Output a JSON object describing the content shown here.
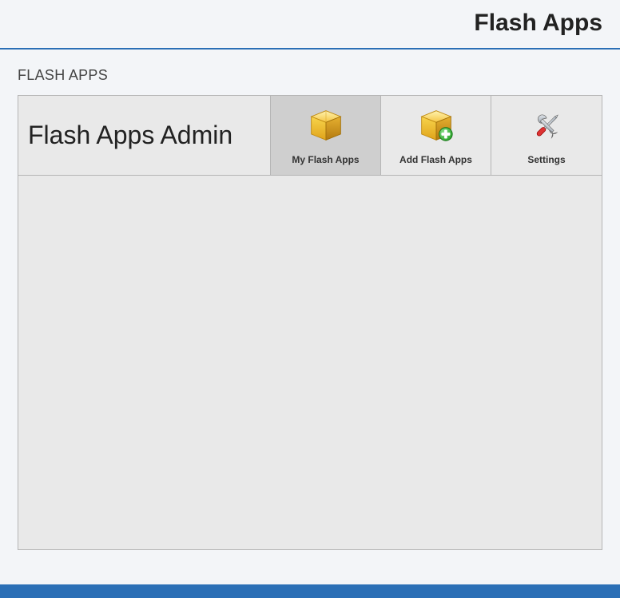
{
  "header": {
    "title": "Flash Apps"
  },
  "page": {
    "heading": "FLASH APPS"
  },
  "admin": {
    "title": "Flash Apps Admin",
    "tabs": [
      {
        "label": "My Flash Apps",
        "icon": "box-icon",
        "active": true
      },
      {
        "label": "Add Flash Apps",
        "icon": "box-add-icon",
        "active": false
      },
      {
        "label": "Settings",
        "icon": "wrench-icon",
        "active": false
      }
    ]
  }
}
